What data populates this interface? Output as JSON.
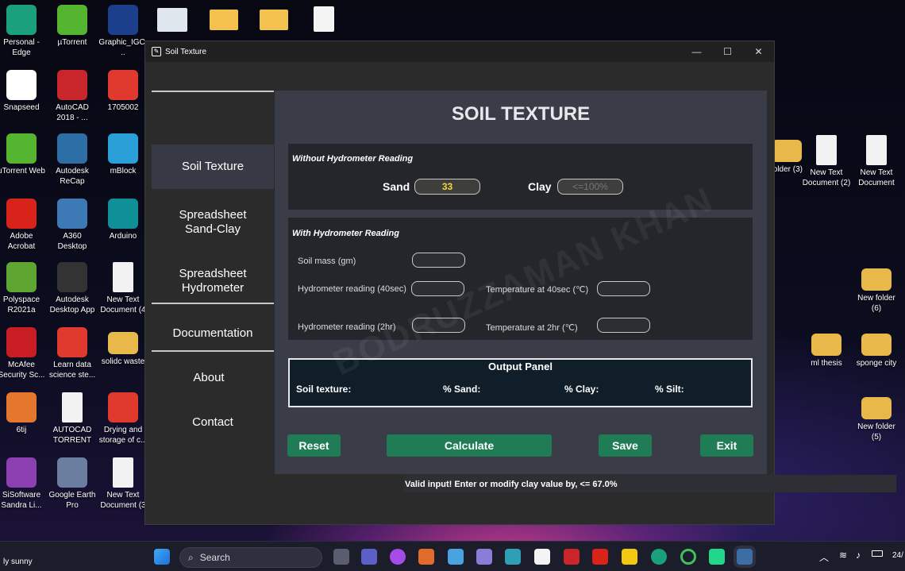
{
  "desktop": {
    "left_icons": [
      {
        "label": "Personal - Edge",
        "icon": "edge-icon",
        "color": "#1aa07a"
      },
      {
        "label": "Snapseed",
        "icon": "snapseed-icon",
        "color": "#ffffff"
      },
      {
        "label": "uTorrent Web",
        "icon": "utorrent-icon",
        "color": "#56b530"
      },
      {
        "label": "Adobe Acrobat",
        "icon": "acrobat-icon",
        "color": "#d8231a"
      },
      {
        "label": "Polyspace R2021a",
        "icon": "polyspace-icon",
        "color": "#5ea532"
      },
      {
        "label": "McAfee Security Sc...",
        "icon": "mcafee-icon",
        "color": "#c81d25"
      },
      {
        "label": "6tij",
        "icon": "image-icon",
        "color": "#e5762d"
      },
      {
        "label": "SiSoftware Sandra Li...",
        "icon": "sisoftware-icon",
        "color": "#8b3fb0"
      }
    ],
    "col2_icons": [
      {
        "label": "µTorrent",
        "icon": "utorrent-icon",
        "color": "#56b530"
      },
      {
        "label": "AutoCAD 2018 - ...",
        "icon": "autocad-icon",
        "color": "#c8262a"
      },
      {
        "label": "Autodesk ReCap",
        "icon": "recap-icon",
        "color": "#2d6ea6"
      },
      {
        "label": "A360 Desktop",
        "icon": "a360-icon",
        "color": "#3d7ab5"
      },
      {
        "label": "Autodesk Desktop App",
        "icon": "autodesk-icon",
        "color": "#333333"
      },
      {
        "label": "Learn data science ste...",
        "icon": "pdf-icon",
        "color": "#e03a2f"
      },
      {
        "label": "AUTOCAD TORRENT",
        "icon": "document-icon",
        "color": "#f2f2f2"
      },
      {
        "label": "Google Earth Pro",
        "icon": "google-earth-icon",
        "color": "#6b7ea0"
      }
    ],
    "col3_icons": [
      {
        "label": "Graphic_IGC...",
        "icon": "asus-icon",
        "color": "#1b3f8a"
      },
      {
        "label": "1705002",
        "icon": "pdf-icon",
        "color": "#e03a2f"
      },
      {
        "label": "mBlock",
        "icon": "mblock-icon",
        "color": "#2a9fd8"
      },
      {
        "label": "Arduino",
        "icon": "arduino-icon",
        "color": "#0f8f96"
      },
      {
        "label": "New Text Document (4",
        "icon": "document-icon",
        "color": "#f2f2f2"
      },
      {
        "label": "solidc waste",
        "icon": "folder-icon",
        "color": "#e8b84a"
      },
      {
        "label": "Drying and storage of c...",
        "icon": "pdf-icon",
        "color": "#e03a2f"
      },
      {
        "label": "New Text Document (3",
        "icon": "document-icon",
        "color": "#f2f2f2"
      }
    ],
    "right_icons": [
      {
        "label": "folder (3)",
        "icon": "folder-icon",
        "color": "#e8b84a"
      },
      {
        "label": "New Text Document (2)",
        "icon": "document-icon",
        "color": "#f2f2f2"
      },
      {
        "label": "New Text Document",
        "icon": "document-icon",
        "color": "#f2f2f2"
      },
      {
        "label": "New folder (6)",
        "icon": "folder-icon",
        "color": "#e8b84a"
      },
      {
        "label": "ml thesis",
        "icon": "folder-icon",
        "color": "#e8b84a"
      },
      {
        "label": "sponge city",
        "icon": "folder-icon",
        "color": "#e8b84a"
      },
      {
        "label": "New folder (5)",
        "icon": "folder-icon",
        "color": "#e8b84a"
      }
    ]
  },
  "window": {
    "title": "Soil Texture",
    "controls": {
      "minimize": "—",
      "maximize": "☐",
      "close": "✕"
    }
  },
  "sidebar": {
    "items": [
      "Soil Texture",
      "Spreadsheet Sand-Clay",
      "Spreadsheet Hydrometer",
      "Documentation",
      "About",
      "Contact"
    ],
    "active": "Soil Texture"
  },
  "main": {
    "title": "SOIL TEXTURE",
    "without_panel": {
      "title": "Without Hydrometer Reading",
      "sand_label": "Sand",
      "sand_value": "33",
      "clay_label": "Clay",
      "clay_placeholder": "<=100%"
    },
    "with_panel": {
      "title": "With Hydrometer Reading",
      "soil_mass_label": "Soil mass (gm)",
      "hydro40_label": "Hydrometer reading (40sec)",
      "temp40_label": "Temperature at 40sec (℃)",
      "hydro2h_label": "Hydrometer reading (2hr)",
      "temp2h_label": "Temperature at 2hr (℃)"
    },
    "output": {
      "title": "Output Panel",
      "soil_texture_label": "Soil texture:",
      "sand_label": "% Sand:",
      "clay_label": "% Clay:",
      "silt_label": "% Silt:"
    },
    "buttons": {
      "reset": "Reset",
      "calculate": "Calculate",
      "save": "Save",
      "exit": "Exit"
    },
    "status": "Valid input! Enter or modify clay value by, <= 67.0%"
  },
  "taskbar": {
    "weather": "ly sunny",
    "search": "Search",
    "time": "24/"
  }
}
